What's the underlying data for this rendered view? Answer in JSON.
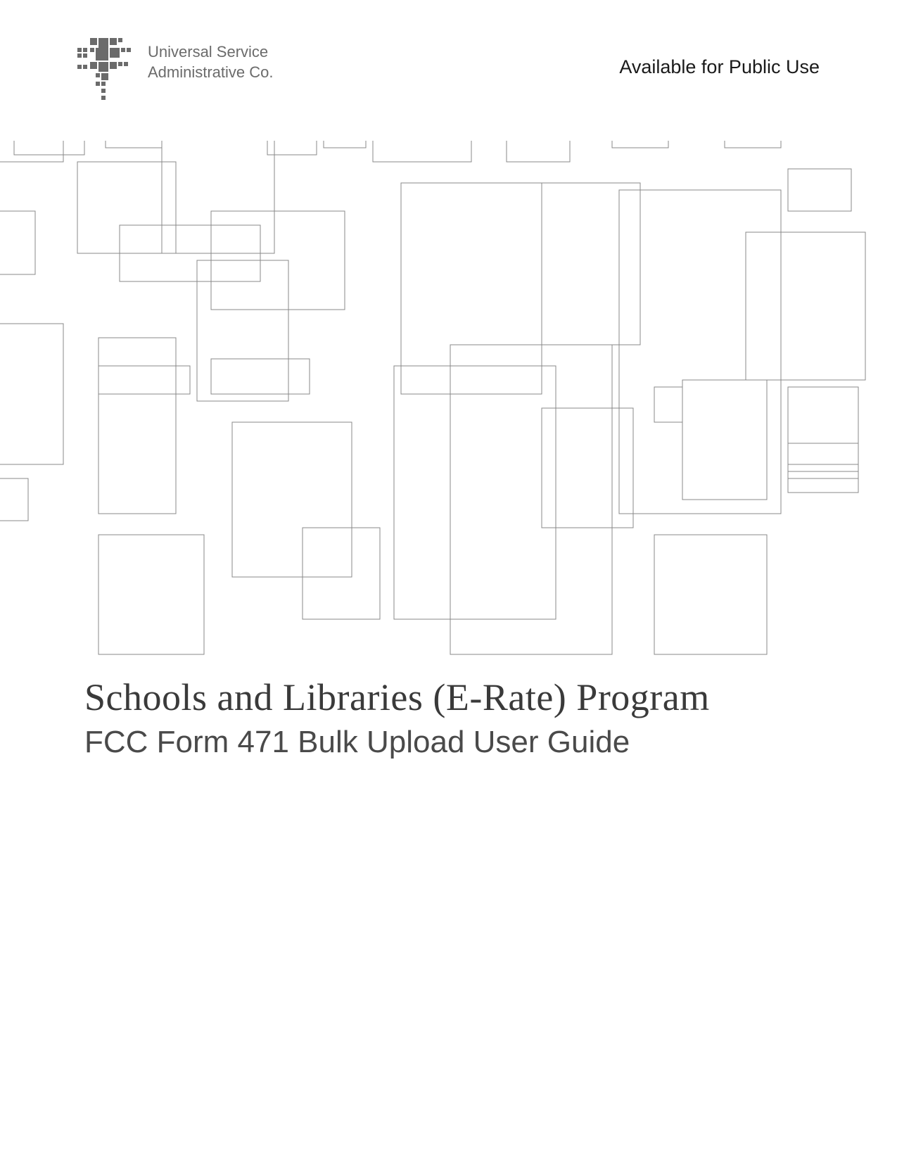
{
  "header": {
    "logo_line1": "Universal Service",
    "logo_line2": "Administrative Co.",
    "availability": "Available for Public Use"
  },
  "title": {
    "main": "Schools and Libraries (E-Rate) Program",
    "sub": "FCC Form 471 Bulk Upload User Guide"
  }
}
